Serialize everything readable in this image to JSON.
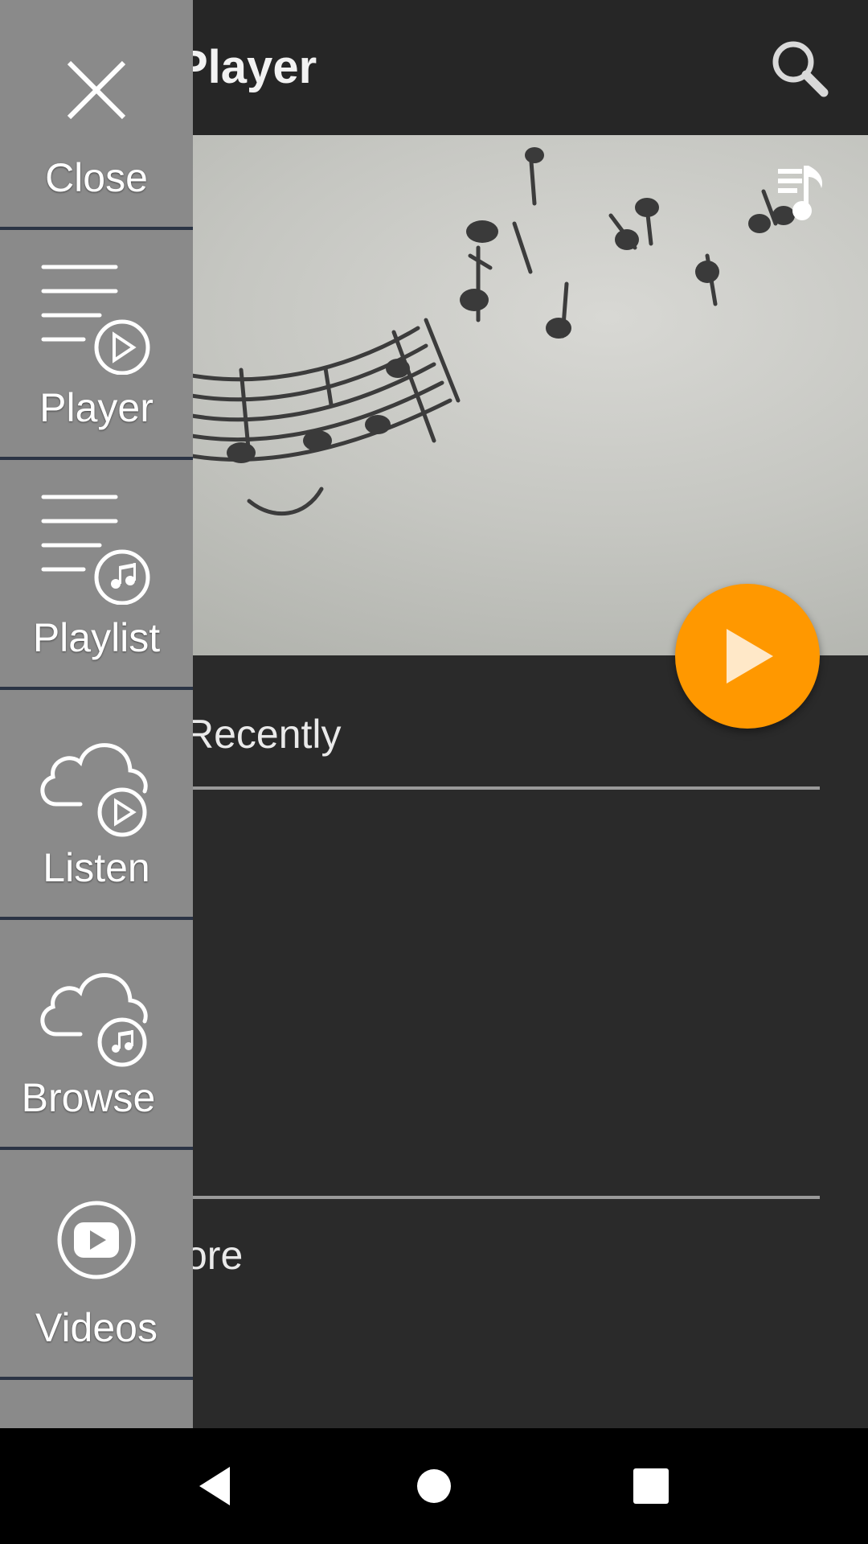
{
  "header": {
    "title": "Player"
  },
  "main": {
    "section_recently": "Recently",
    "section_more": "ore"
  },
  "drawer": {
    "items": [
      {
        "label": "Close",
        "icon": "close-icon"
      },
      {
        "label": "Player",
        "icon": "player-list-icon"
      },
      {
        "label": "Playlist",
        "icon": "playlist-music-icon"
      },
      {
        "label": "Listen",
        "icon": "cloud-play-icon"
      },
      {
        "label": "Browse",
        "icon": "cloud-music-icon"
      },
      {
        "label": "Videos",
        "icon": "youtube-icon"
      }
    ]
  },
  "colors": {
    "accent": "#ff9800",
    "drawer_bg": "#8a8a8a",
    "app_bg": "#2a2a2a",
    "divider": "#2b3445"
  }
}
